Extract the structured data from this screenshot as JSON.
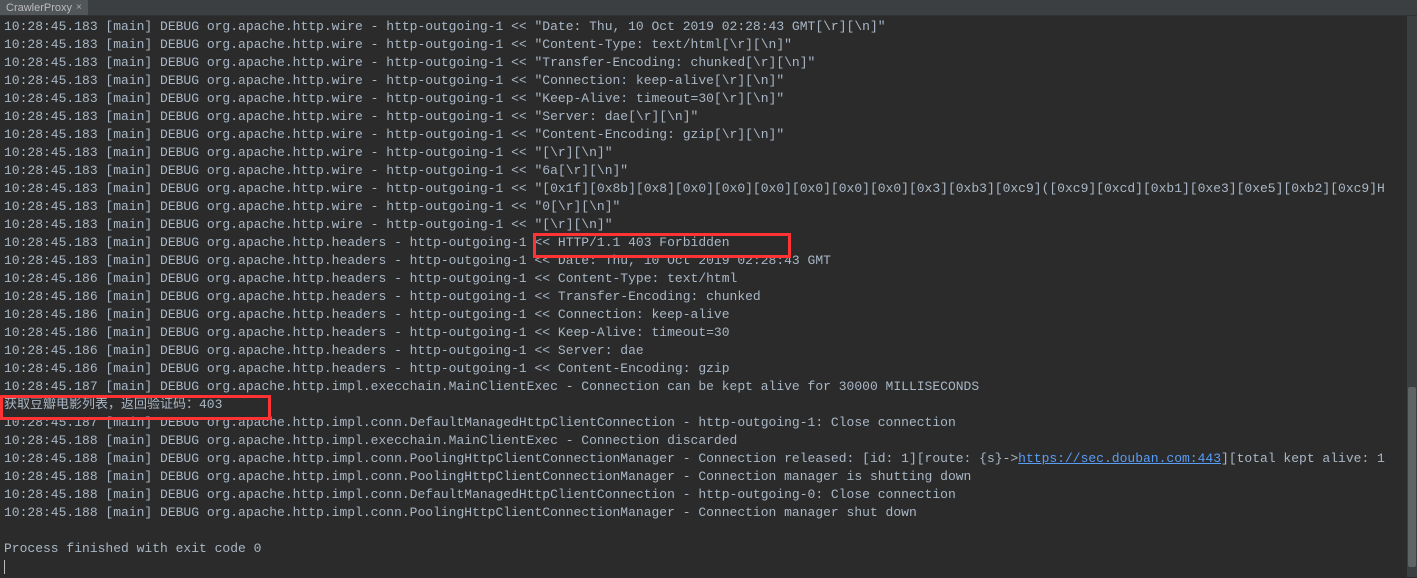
{
  "tab": {
    "title": "CrawlerProxy",
    "close": "×"
  },
  "lines": [
    {
      "t": "10:28:45.183",
      "th": "[main]",
      "lv": "DEBUG",
      "lg": "org.apache.http.wire",
      "m": " - http-outgoing-1 << \"Date: Thu, 10 Oct 2019 02:28:43 GMT[\\r][\\n]\""
    },
    {
      "t": "10:28:45.183",
      "th": "[main]",
      "lv": "DEBUG",
      "lg": "org.apache.http.wire",
      "m": " - http-outgoing-1 << \"Content-Type: text/html[\\r][\\n]\""
    },
    {
      "t": "10:28:45.183",
      "th": "[main]",
      "lv": "DEBUG",
      "lg": "org.apache.http.wire",
      "m": " - http-outgoing-1 << \"Transfer-Encoding: chunked[\\r][\\n]\""
    },
    {
      "t": "10:28:45.183",
      "th": "[main]",
      "lv": "DEBUG",
      "lg": "org.apache.http.wire",
      "m": " - http-outgoing-1 << \"Connection: keep-alive[\\r][\\n]\""
    },
    {
      "t": "10:28:45.183",
      "th": "[main]",
      "lv": "DEBUG",
      "lg": "org.apache.http.wire",
      "m": " - http-outgoing-1 << \"Keep-Alive: timeout=30[\\r][\\n]\""
    },
    {
      "t": "10:28:45.183",
      "th": "[main]",
      "lv": "DEBUG",
      "lg": "org.apache.http.wire",
      "m": " - http-outgoing-1 << \"Server: dae[\\r][\\n]\""
    },
    {
      "t": "10:28:45.183",
      "th": "[main]",
      "lv": "DEBUG",
      "lg": "org.apache.http.wire",
      "m": " - http-outgoing-1 << \"Content-Encoding: gzip[\\r][\\n]\""
    },
    {
      "t": "10:28:45.183",
      "th": "[main]",
      "lv": "DEBUG",
      "lg": "org.apache.http.wire",
      "m": " - http-outgoing-1 << \"[\\r][\\n]\""
    },
    {
      "t": "10:28:45.183",
      "th": "[main]",
      "lv": "DEBUG",
      "lg": "org.apache.http.wire",
      "m": " - http-outgoing-1 << \"6a[\\r][\\n]\""
    },
    {
      "t": "10:28:45.183",
      "th": "[main]",
      "lv": "DEBUG",
      "lg": "org.apache.http.wire",
      "m": " - http-outgoing-1 << \"[0x1f][0x8b][0x8][0x0][0x0][0x0][0x0][0x0][0x0][0x3][0xb3][0xc9]([0xc9][0xcd][0xb1][0xe3][0xe5][0xb2][0xc9]H"
    },
    {
      "t": "10:28:45.183",
      "th": "[main]",
      "lv": "DEBUG",
      "lg": "org.apache.http.wire",
      "m": " - http-outgoing-1 << \"0[\\r][\\n]\""
    },
    {
      "t": "10:28:45.183",
      "th": "[main]",
      "lv": "DEBUG",
      "lg": "org.apache.http.wire",
      "m": " - http-outgoing-1 << \"[\\r][\\n]\""
    },
    {
      "t": "10:28:45.183",
      "th": "[main]",
      "lv": "DEBUG",
      "lg": "org.apache.http.headers",
      "m": " - http-outgoing-1 << HTTP/1.1 403 Forbidden"
    },
    {
      "t": "10:28:45.183",
      "th": "[main]",
      "lv": "DEBUG",
      "lg": "org.apache.http.headers",
      "m": " - http-outgoing-1 << Date: Thu, 10 Oct 2019 02:28:43 GMT"
    },
    {
      "t": "10:28:45.186",
      "th": "[main]",
      "lv": "DEBUG",
      "lg": "org.apache.http.headers",
      "m": " - http-outgoing-1 << Content-Type: text/html"
    },
    {
      "t": "10:28:45.186",
      "th": "[main]",
      "lv": "DEBUG",
      "lg": "org.apache.http.headers",
      "m": " - http-outgoing-1 << Transfer-Encoding: chunked"
    },
    {
      "t": "10:28:45.186",
      "th": "[main]",
      "lv": "DEBUG",
      "lg": "org.apache.http.headers",
      "m": " - http-outgoing-1 << Connection: keep-alive"
    },
    {
      "t": "10:28:45.186",
      "th": "[main]",
      "lv": "DEBUG",
      "lg": "org.apache.http.headers",
      "m": " - http-outgoing-1 << Keep-Alive: timeout=30"
    },
    {
      "t": "10:28:45.186",
      "th": "[main]",
      "lv": "DEBUG",
      "lg": "org.apache.http.headers",
      "m": " - http-outgoing-1 << Server: dae"
    },
    {
      "t": "10:28:45.186",
      "th": "[main]",
      "lv": "DEBUG",
      "lg": "org.apache.http.headers",
      "m": " - http-outgoing-1 << Content-Encoding: gzip"
    },
    {
      "t": "10:28:45.187",
      "th": "[main]",
      "lv": "DEBUG",
      "lg": "org.apache.http.impl.execchain.MainClientExec",
      "m": " - Connection can be kept alive for 30000 MILLISECONDS"
    }
  ],
  "error_line": "获取豆瓣电影列表，返回验证码：403",
  "lines2": [
    {
      "t": "10:28:45.187",
      "th": "[main]",
      "lv": "DEBUG",
      "lg": "org.apache.http.impl.conn.DefaultManagedHttpClientConnection",
      "m": " - http-outgoing-1: Close connection"
    },
    {
      "t": "10:28:45.188",
      "th": "[main]",
      "lv": "DEBUG",
      "lg": "org.apache.http.impl.execchain.MainClientExec",
      "m": " - Connection discarded"
    }
  ],
  "link_line": {
    "t": "10:28:45.188",
    "th": "[main]",
    "lv": "DEBUG",
    "lg": "org.apache.http.impl.conn.PoolingHttpClientConnectionManager",
    "m1": " - Connection released: [id: 1][route: {s}->",
    "link": "https://sec.douban.com:443",
    "m2": "][total kept alive: 1"
  },
  "lines3": [
    {
      "t": "10:28:45.188",
      "th": "[main]",
      "lv": "DEBUG",
      "lg": "org.apache.http.impl.conn.PoolingHttpClientConnectionManager",
      "m": " - Connection manager is shutting down"
    },
    {
      "t": "10:28:45.188",
      "th": "[main]",
      "lv": "DEBUG",
      "lg": "org.apache.http.impl.conn.DefaultManagedHttpClientConnection",
      "m": " - http-outgoing-0: Close connection"
    },
    {
      "t": "10:28:45.188",
      "th": "[main]",
      "lv": "DEBUG",
      "lg": "org.apache.http.impl.conn.PoolingHttpClientConnectionManager",
      "m": " - Connection manager shut down"
    }
  ],
  "exit_line": "Process finished with exit code 0"
}
